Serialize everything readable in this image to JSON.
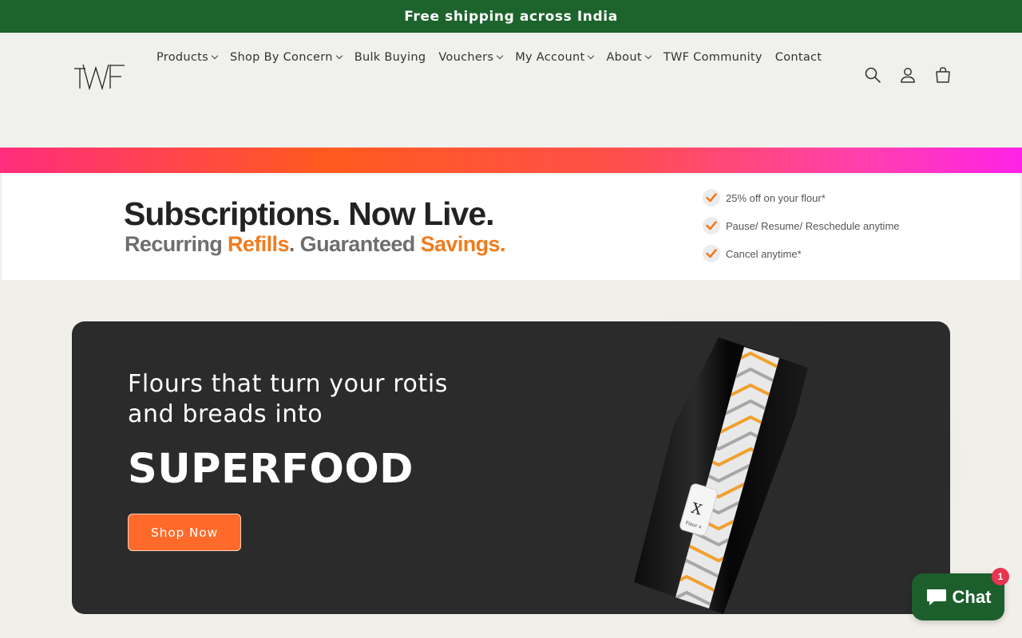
{
  "announcement": {
    "text": "Free shipping across India"
  },
  "header": {
    "logo_text": "TWF",
    "nav": [
      {
        "label": "Products",
        "has_dropdown": true
      },
      {
        "label": "Shop By Concern",
        "has_dropdown": true
      },
      {
        "label": "Bulk Buying",
        "has_dropdown": false
      },
      {
        "label": "Vouchers",
        "has_dropdown": true
      },
      {
        "label": "My Account",
        "has_dropdown": true
      },
      {
        "label": "About",
        "has_dropdown": true
      },
      {
        "label": "TWF Community",
        "has_dropdown": false
      },
      {
        "label": "Contact",
        "has_dropdown": false
      }
    ],
    "icons": [
      "search-icon",
      "account-icon",
      "cart-icon"
    ]
  },
  "subscription_banner": {
    "headline": "Subscriptions. Now Live.",
    "tagline_part1": "Recurring ",
    "tagline_hl1": "Refills",
    "tagline_part2": ". Guaranteed ",
    "tagline_hl2": "Savings",
    "tagline_end": ".",
    "benefits": [
      "25% off on your flour*",
      "Pause/ Resume/ Reschedule  anytime",
      "Cancel anytime*"
    ],
    "accent_color": "#f07c1e"
  },
  "hero": {
    "subtitle": "Flours that turn your rotis and breads into",
    "title": "SUPERFOOD",
    "cta_label": "Shop Now",
    "product_label": "X",
    "product_sublabel": "Flour x"
  },
  "chat": {
    "label": "Chat",
    "badge_count": "1"
  },
  "colors": {
    "brand_green": "#1c632c",
    "cta_orange": "#ff6a2a",
    "hero_bg": "#2b2b2b"
  }
}
